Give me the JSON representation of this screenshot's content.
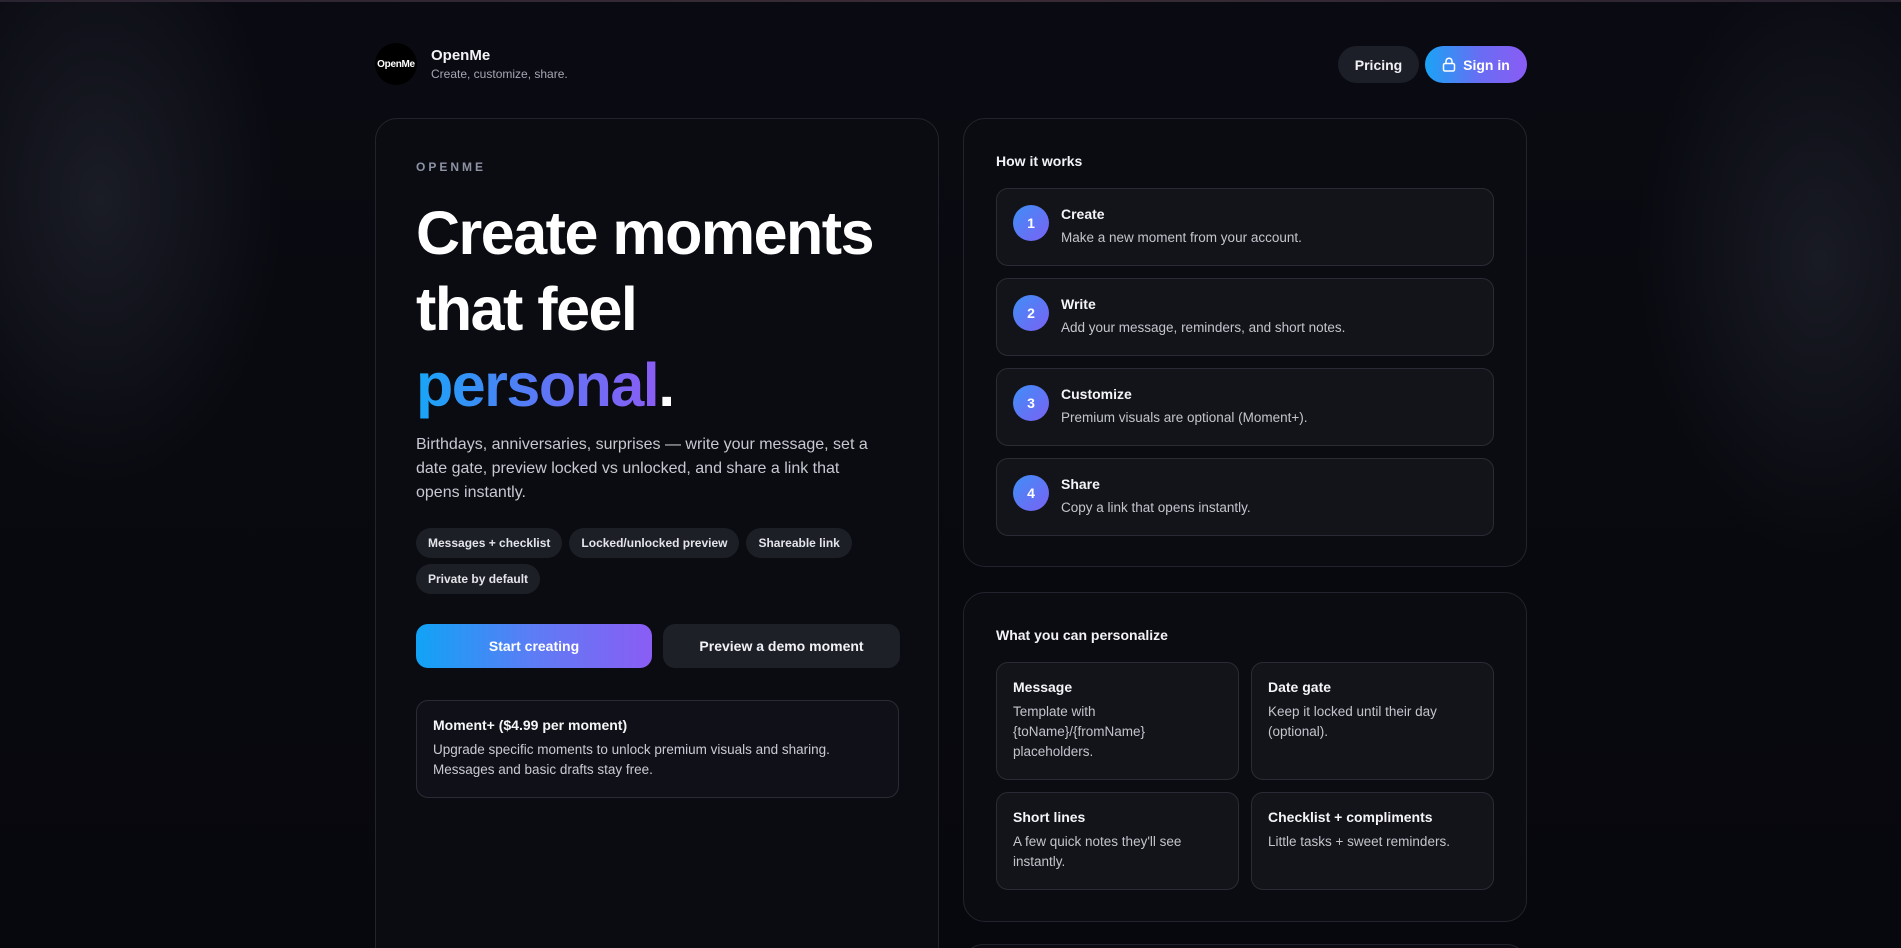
{
  "header": {
    "logo_text": "OpenMe",
    "brand_name": "OpenMe",
    "tagline": "Create, customize, share.",
    "pricing_label": "Pricing",
    "signin_label": "Sign in"
  },
  "hero": {
    "eyebrow": "OPENME",
    "headline_part1": "Create moments that feel ",
    "headline_accent": "personal",
    "headline_end": ".",
    "lede": "Birthdays, anniversaries, surprises — write your message, set a date gate, preview locked vs unlocked, and share a link that opens instantly.",
    "chips": [
      "Messages + checklist",
      "Locked/unlocked preview",
      "Shareable link",
      "Private by default"
    ],
    "start_label": "Start creating",
    "demo_label": "Preview a demo moment",
    "promo_title": "Moment+ ($4.99 per moment)",
    "promo_text": "Upgrade specific moments to unlock premium visuals and sharing. Messages and basic drafts stay free."
  },
  "how": {
    "title": "How it works",
    "steps": [
      {
        "num": "1",
        "title": "Create",
        "desc": "Make a new moment from your account."
      },
      {
        "num": "2",
        "title": "Write",
        "desc": "Add your message, reminders, and short notes."
      },
      {
        "num": "3",
        "title": "Customize",
        "desc": "Premium visuals are optional (Moment+)."
      },
      {
        "num": "4",
        "title": "Share",
        "desc": "Copy a link that opens instantly."
      }
    ]
  },
  "personalize": {
    "title": "What you can personalize",
    "tiles": [
      {
        "title": "Message",
        "desc": "Template with {toName}/{fromName} placeholders."
      },
      {
        "title": "Date gate",
        "desc": "Keep it locked until their day (optional)."
      },
      {
        "title": "Short lines",
        "desc": "A few quick notes they'll see instantly."
      },
      {
        "title": "Checklist + compliments",
        "desc": "Little tasks + sweet reminders."
      }
    ]
  },
  "colors": {
    "background": "#07080d",
    "card": "#0b0c11",
    "accent_blue": "#17a6f7",
    "accent_purple": "#8a5df4"
  }
}
